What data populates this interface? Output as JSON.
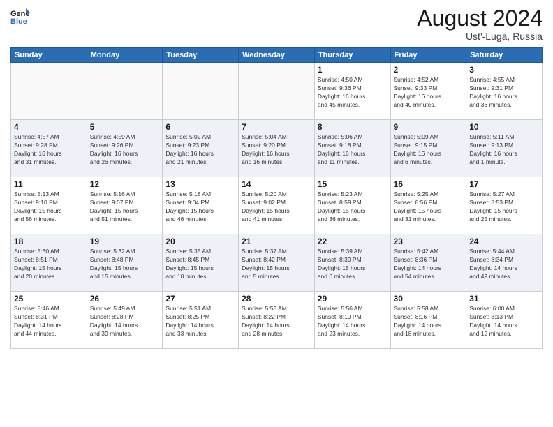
{
  "header": {
    "logo_line1": "General",
    "logo_line2": "Blue",
    "month_year": "August 2024",
    "location": "Ust'-Luga, Russia"
  },
  "weekdays": [
    "Sunday",
    "Monday",
    "Tuesday",
    "Wednesday",
    "Thursday",
    "Friday",
    "Saturday"
  ],
  "weeks": [
    [
      {
        "day": "",
        "info": ""
      },
      {
        "day": "",
        "info": ""
      },
      {
        "day": "",
        "info": ""
      },
      {
        "day": "",
        "info": ""
      },
      {
        "day": "1",
        "info": "Sunrise: 4:50 AM\nSunset: 9:36 PM\nDaylight: 16 hours\nand 45 minutes."
      },
      {
        "day": "2",
        "info": "Sunrise: 4:52 AM\nSunset: 9:33 PM\nDaylight: 16 hours\nand 40 minutes."
      },
      {
        "day": "3",
        "info": "Sunrise: 4:55 AM\nSunset: 9:31 PM\nDaylight: 16 hours\nand 36 minutes."
      }
    ],
    [
      {
        "day": "4",
        "info": "Sunrise: 4:57 AM\nSunset: 9:28 PM\nDaylight: 16 hours\nand 31 minutes."
      },
      {
        "day": "5",
        "info": "Sunrise: 4:59 AM\nSunset: 9:26 PM\nDaylight: 16 hours\nand 26 minutes."
      },
      {
        "day": "6",
        "info": "Sunrise: 5:02 AM\nSunset: 9:23 PM\nDaylight: 16 hours\nand 21 minutes."
      },
      {
        "day": "7",
        "info": "Sunrise: 5:04 AM\nSunset: 9:20 PM\nDaylight: 16 hours\nand 16 minutes."
      },
      {
        "day": "8",
        "info": "Sunrise: 5:06 AM\nSunset: 9:18 PM\nDaylight: 16 hours\nand 11 minutes."
      },
      {
        "day": "9",
        "info": "Sunrise: 5:09 AM\nSunset: 9:15 PM\nDaylight: 16 hours\nand 6 minutes."
      },
      {
        "day": "10",
        "info": "Sunrise: 5:11 AM\nSunset: 9:13 PM\nDaylight: 16 hours\nand 1 minute."
      }
    ],
    [
      {
        "day": "11",
        "info": "Sunrise: 5:13 AM\nSunset: 9:10 PM\nDaylight: 15 hours\nand 56 minutes."
      },
      {
        "day": "12",
        "info": "Sunrise: 5:16 AM\nSunset: 9:07 PM\nDaylight: 15 hours\nand 51 minutes."
      },
      {
        "day": "13",
        "info": "Sunrise: 5:18 AM\nSunset: 9:04 PM\nDaylight: 15 hours\nand 46 minutes."
      },
      {
        "day": "14",
        "info": "Sunrise: 5:20 AM\nSunset: 9:02 PM\nDaylight: 15 hours\nand 41 minutes."
      },
      {
        "day": "15",
        "info": "Sunrise: 5:23 AM\nSunset: 8:59 PM\nDaylight: 15 hours\nand 36 minutes."
      },
      {
        "day": "16",
        "info": "Sunrise: 5:25 AM\nSunset: 8:56 PM\nDaylight: 15 hours\nand 31 minutes."
      },
      {
        "day": "17",
        "info": "Sunrise: 5:27 AM\nSunset: 8:53 PM\nDaylight: 15 hours\nand 25 minutes."
      }
    ],
    [
      {
        "day": "18",
        "info": "Sunrise: 5:30 AM\nSunset: 8:51 PM\nDaylight: 15 hours\nand 20 minutes."
      },
      {
        "day": "19",
        "info": "Sunrise: 5:32 AM\nSunset: 8:48 PM\nDaylight: 15 hours\nand 15 minutes."
      },
      {
        "day": "20",
        "info": "Sunrise: 5:35 AM\nSunset: 8:45 PM\nDaylight: 15 hours\nand 10 minutes."
      },
      {
        "day": "21",
        "info": "Sunrise: 5:37 AM\nSunset: 8:42 PM\nDaylight: 15 hours\nand 5 minutes."
      },
      {
        "day": "22",
        "info": "Sunrise: 5:39 AM\nSunset: 8:39 PM\nDaylight: 15 hours\nand 0 minutes."
      },
      {
        "day": "23",
        "info": "Sunrise: 5:42 AM\nSunset: 8:36 PM\nDaylight: 14 hours\nand 54 minutes."
      },
      {
        "day": "24",
        "info": "Sunrise: 5:44 AM\nSunset: 8:34 PM\nDaylight: 14 hours\nand 49 minutes."
      }
    ],
    [
      {
        "day": "25",
        "info": "Sunrise: 5:46 AM\nSunset: 8:31 PM\nDaylight: 14 hours\nand 44 minutes."
      },
      {
        "day": "26",
        "info": "Sunrise: 5:49 AM\nSunset: 8:28 PM\nDaylight: 14 hours\nand 39 minutes."
      },
      {
        "day": "27",
        "info": "Sunrise: 5:51 AM\nSunset: 8:25 PM\nDaylight: 14 hours\nand 33 minutes."
      },
      {
        "day": "28",
        "info": "Sunrise: 5:53 AM\nSunset: 8:22 PM\nDaylight: 14 hours\nand 28 minutes."
      },
      {
        "day": "29",
        "info": "Sunrise: 5:56 AM\nSunset: 8:19 PM\nDaylight: 14 hours\nand 23 minutes."
      },
      {
        "day": "30",
        "info": "Sunrise: 5:58 AM\nSunset: 8:16 PM\nDaylight: 14 hours\nand 18 minutes."
      },
      {
        "day": "31",
        "info": "Sunrise: 6:00 AM\nSunset: 8:13 PM\nDaylight: 14 hours\nand 12 minutes."
      }
    ]
  ]
}
